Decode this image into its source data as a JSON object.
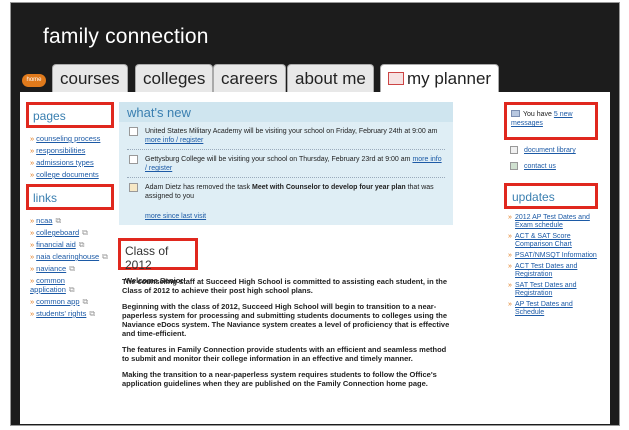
{
  "app": {
    "title": "family connection"
  },
  "nav": {
    "home": "home",
    "tabs": [
      "courses",
      "colleges",
      "careers",
      "about me",
      "my planner"
    ]
  },
  "pages": {
    "title": "pages",
    "items": [
      "counseling process",
      "responsibilities",
      "admissions types",
      "college documents"
    ]
  },
  "links": {
    "title": "links",
    "items": [
      "ncaa",
      "collegeboard",
      "financial aid",
      "naia clearinghouse",
      "naviance",
      "common application",
      "common app",
      "students' rights"
    ]
  },
  "whats_new": {
    "title": "what's new",
    "items": [
      {
        "text": "United States Military Academy will be visiting your school on Friday, February 24th at 9:00 am",
        "link": "more info / register"
      },
      {
        "text": "Gettysburg College will be visiting your school on Thursday, February 23rd at 9:00 am",
        "link": "more info / register"
      },
      {
        "text_pre": "Adam Dietz has removed the task ",
        "text_bold": "Meet with Counselor to develop four year plan",
        "text_post": " that was assigned to you"
      }
    ],
    "more": "more since last visit"
  },
  "main": {
    "title": "Class of 2012",
    "subtitle": "Welcome Senior!",
    "paragraphs": [
      "The counseling staff at Succeed High School is committed to assisting each student, in the Class of 2012 to achieve their post high school plans.",
      "Beginning with the class of 2012, Succeed High School will begin to transition to a near-paperless system for processing and submitting students documents to colleges using the Naviance eDocs system. The Naviance system creates a level of proficiency that is effective and time-efficient.",
      "The features in Family Connection provide students with an efficient and seamless method to submit and monitor their college information in an effective and timely manner.",
      "Making the transition to a near-paperless system requires students to follow the Office's application guidelines when they are published on the Family Connection home page."
    ]
  },
  "sidebar_right": {
    "messages_pre": "You have ",
    "messages_link": "5 new messages",
    "document_library": "document library",
    "contact_us": "contact us",
    "updates_title": "updates",
    "updates": [
      "2012 AP Test Dates and Exam schedule",
      "ACT & SAT Score Comparison Chart",
      "PSAT/NMSQT Information",
      "ACT Test Dates and Registration",
      "SAT Test Dates and Registration",
      "AP Test Dates and Schedule"
    ]
  },
  "colors": {
    "accent_red": "#e0281e",
    "link_blue": "#1c5aa6",
    "header_bg": "#1c1c1c",
    "orange": "#e07a1c"
  }
}
